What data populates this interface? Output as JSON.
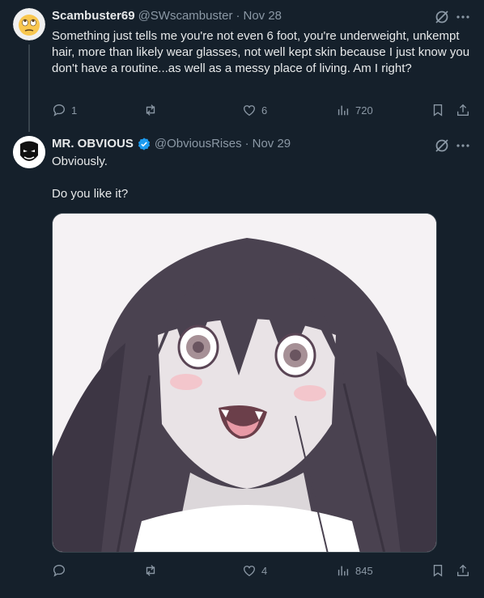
{
  "tweet1": {
    "name": "Scambuster69",
    "handle": "@SWscambuster",
    "separator": "·",
    "date": "Nov 28",
    "text": "Something just tells me you're not even 6 foot, you're underweight, unkempt hair, more than likely wear glasses, not well kept skin because I just know you don't have a routine...as well as a messy place of living. Am I right?",
    "replies": "1",
    "likes": "6",
    "views": "720",
    "avatar_icon": "rolling-eyes-emoji-icon"
  },
  "tweet2": {
    "name": "MR. OBVIOUS",
    "handle": "@ObviousRises",
    "separator": "·",
    "date": "Nov 29",
    "text": "Obviously.\n\nDo you like it?",
    "replies": "",
    "likes": "4",
    "views": "845",
    "avatar_icon": "white-mask-icon",
    "media": "anime-girl-illustration"
  },
  "colors": {
    "background": "#15202b",
    "text": "#e7e9ea",
    "secondary": "#8b98a5",
    "verified": "#1d9bf0"
  }
}
